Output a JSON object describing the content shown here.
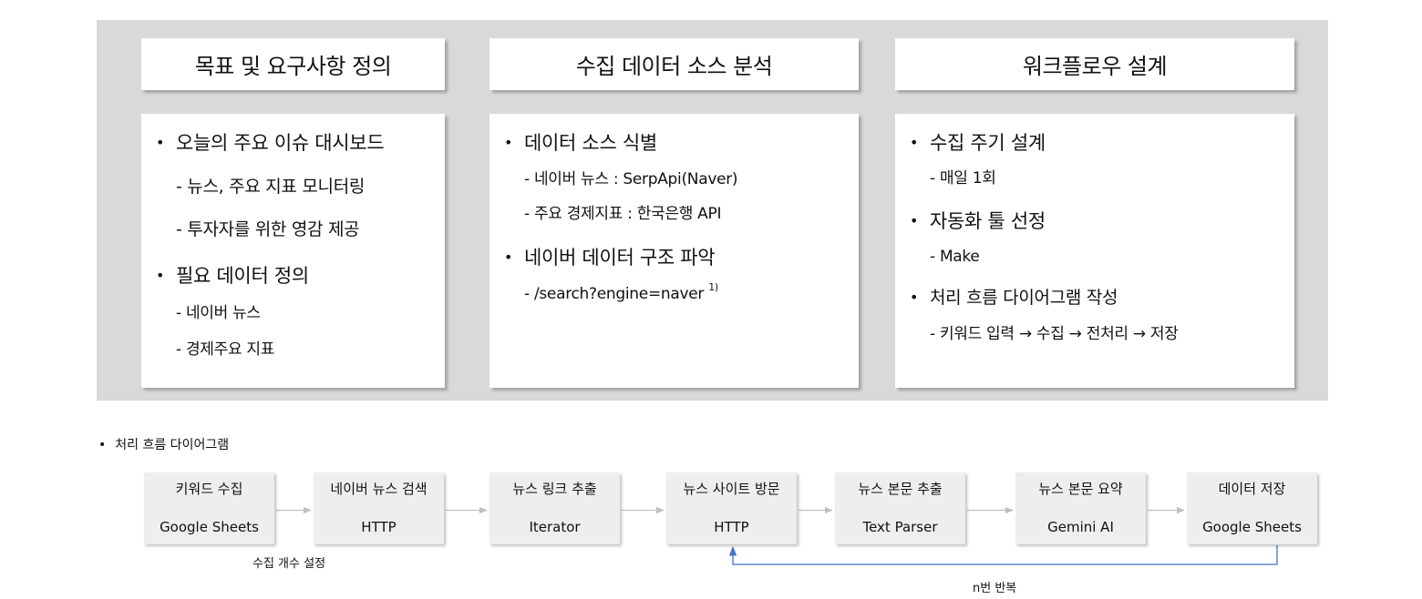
{
  "columns": [
    {
      "title": "목표 및 요구사항 정의",
      "items": [
        {
          "level": 1,
          "text": "오늘의 주요 이슈 대시보드"
        },
        {
          "level": 2,
          "text": "- 뉴스, 주요 지표 모니터링"
        },
        {
          "level": 2,
          "text": "- 투자자를 위한 영감 제공"
        },
        {
          "level": 1,
          "text": "필요 데이터 정의"
        },
        {
          "level": 3,
          "text": "- 네이버 뉴스"
        },
        {
          "level": 3,
          "text": "- 경제주요 지표"
        }
      ]
    },
    {
      "title": "수집 데이터 소스 분석",
      "items": [
        {
          "level": 1,
          "text": "데이터 소스 식별"
        },
        {
          "level": 3,
          "text": "- 네이버 뉴스 : SerpApi(Naver)"
        },
        {
          "level": 3,
          "text": "- 주요 경제지표 : 한국은행 API"
        },
        {
          "level": 1,
          "text": "네이버 데이터 구조 파악"
        },
        {
          "level": 3,
          "text": "- /search?engine=naver",
          "sup": "1)"
        }
      ]
    },
    {
      "title": "워크플로우 설계",
      "items": [
        {
          "level": 1,
          "text": "수집 주기 설계"
        },
        {
          "level": 3,
          "text": "- 매일 1회"
        },
        {
          "level": 1,
          "text": "자동화 툴 선정"
        },
        {
          "level": 3,
          "text": "- Make"
        },
        {
          "level": 1,
          "text": "처리 흐름 다이어그램 작성"
        },
        {
          "level": 3,
          "text": "- 키워드 입력 → 수집 → 전처리 → 저장"
        }
      ]
    }
  ],
  "flow": {
    "heading": "처리 흐름 다이어그램",
    "bullet": "•",
    "steps": [
      {
        "title": "키워드 수집",
        "sub": "Google Sheets"
      },
      {
        "title": "네이버 뉴스 검색",
        "sub": "HTTP"
      },
      {
        "title": "뉴스 링크 추출",
        "sub": "Iterator"
      },
      {
        "title": "뉴스 사이트 방문",
        "sub": "HTTP"
      },
      {
        "title": "뉴스 본문 추출",
        "sub": "Text Parser"
      },
      {
        "title": "뉴스 본문 요약",
        "sub": "Gemini AI"
      },
      {
        "title": "데이터 저장",
        "sub": "Google Sheets"
      }
    ],
    "note_below_first": "수집 개수 설정",
    "loop_label": "n번 반복"
  },
  "colors": {
    "panel": "#d9d9d9",
    "flow_box": "#eeeeee",
    "arrow": "#bfbfbf",
    "loop": "#4472c4"
  }
}
